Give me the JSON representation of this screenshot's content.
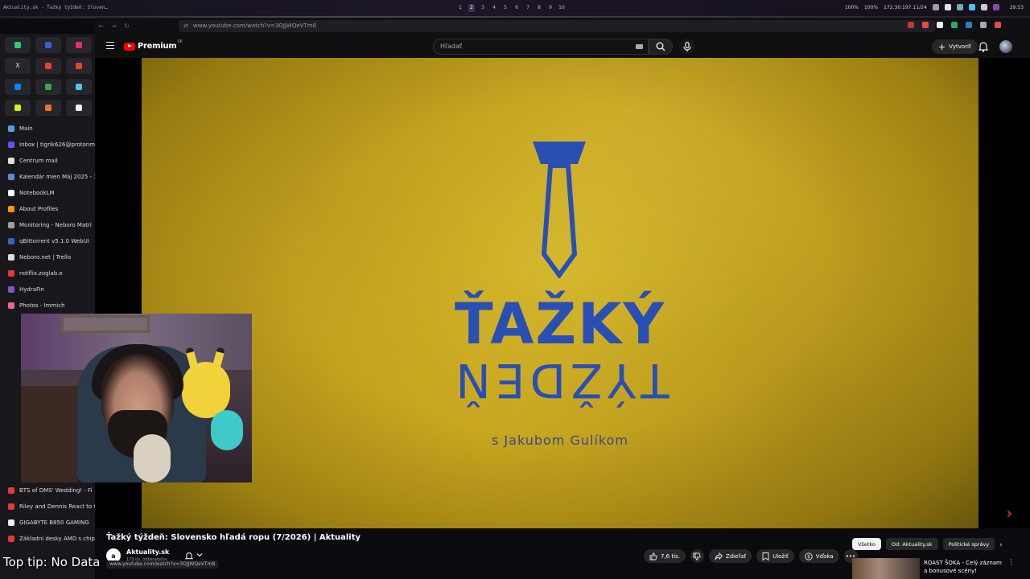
{
  "system_bar": {
    "window_title": "Aktuality.sk - Ťažký týždeň: Sloven…",
    "workspaces": [
      "1",
      "2",
      "3",
      "4",
      "5",
      "6",
      "7",
      "8",
      "9",
      "10"
    ],
    "active_workspace": "2",
    "battery1": "100%",
    "battery2": "100%",
    "ip": "172.30.197.11/24",
    "clock": "29:53"
  },
  "browser": {
    "url": "www.youtube.com/watch?v=3OJJWQeVTm8",
    "pinned_tabs": [
      {
        "icon": "whatsapp-icon",
        "color": "#25d366"
      },
      {
        "icon": "app-icon",
        "color": "#3b5bdb"
      },
      {
        "icon": "instagram-icon",
        "color": "#e1306c"
      },
      {
        "icon": "x-icon",
        "color": "#dddddd",
        "glyph": "X"
      },
      {
        "icon": "gmail-icon",
        "color": "#ea4335"
      },
      {
        "icon": "gmail-icon",
        "color": "#ea4335"
      },
      {
        "icon": "messenger-icon",
        "color": "#0084ff"
      },
      {
        "icon": "drive-icon",
        "color": "#34a853"
      },
      {
        "icon": "chat-icon",
        "color": "#4fc3f7"
      },
      {
        "icon": "note-icon",
        "color": "#c6ff00"
      },
      {
        "icon": "gitlab-icon",
        "color": "#fc6d26"
      },
      {
        "icon": "github-icon",
        "color": "#eeeeee"
      }
    ],
    "tabs": [
      {
        "label": "Main",
        "color": "#4aa3df"
      },
      {
        "label": "Inbox | tigrik626@protonm",
        "color": "#6d4aff"
      },
      {
        "label": "Centrum mail",
        "color": "#e0e0e0"
      },
      {
        "label": "Kalendár mien Máj 2025 - 1",
        "color": "#5c8dd6"
      },
      {
        "label": "NotebookLM",
        "color": "#ffffff"
      },
      {
        "label": "About Profiles",
        "color": "#ff9800"
      },
      {
        "label": "Monitoring - Neboro Matri",
        "color": "#9e9e9e"
      },
      {
        "label": "qBittorrent v5.1.0 WebUI",
        "color": "#2f67ba"
      },
      {
        "label": "Neboro.net | Trello",
        "color": "#dddddd"
      },
      {
        "label": "notflix.zoglab.e",
        "color": "#e53935"
      },
      {
        "label": "HydraFin",
        "color": "#7e57c2"
      },
      {
        "label": "Photos - Immich",
        "color": "#f06292"
      }
    ],
    "tabs_bottom": [
      {
        "label": "BTS of DMS' Wedding! - Fi",
        "color": "#e53935"
      },
      {
        "label": "Riley and Dennis React to C",
        "color": "#e53935"
      },
      {
        "label": "GIGABYTE B850 GAMING",
        "color": "#eeeeee"
      },
      {
        "label": "Základní desky AMD s chip",
        "color": "#e53935"
      }
    ]
  },
  "youtube": {
    "brand": "Premium",
    "region": "SK",
    "search_placeholder": "Hľadať",
    "create_label": "Vytvoriť",
    "video": {
      "show_title_1": "ŤAŽKÝ",
      "show_title_2": "TÝŽDEŇ",
      "show_subtitle": "s Jakubom Gulíkom",
      "title": "Ťažký týždeň: Slovensko hľadá ropu (7/2026) | Aktuality",
      "channel": "Aktuality.sk",
      "channel_initial": "a",
      "subscribers": "179 tis. odberateľov",
      "likes": "7,6 tis.",
      "share_label": "Zdieľať",
      "save_label": "Uložiť",
      "thanks_label": "Vďaka"
    },
    "chips": [
      "Všetko",
      "Od: Aktuality.sk",
      "Politické správy"
    ],
    "active_chip": "Všetko",
    "recommendation": {
      "title": "ROAST ŠOKA - Celý záznam a bonusové scény!"
    },
    "status_url": "www.youtube.com/watch?v=3OJJWQeVTm8"
  },
  "overlay": {
    "top_tip": "Top tip: No Data"
  }
}
